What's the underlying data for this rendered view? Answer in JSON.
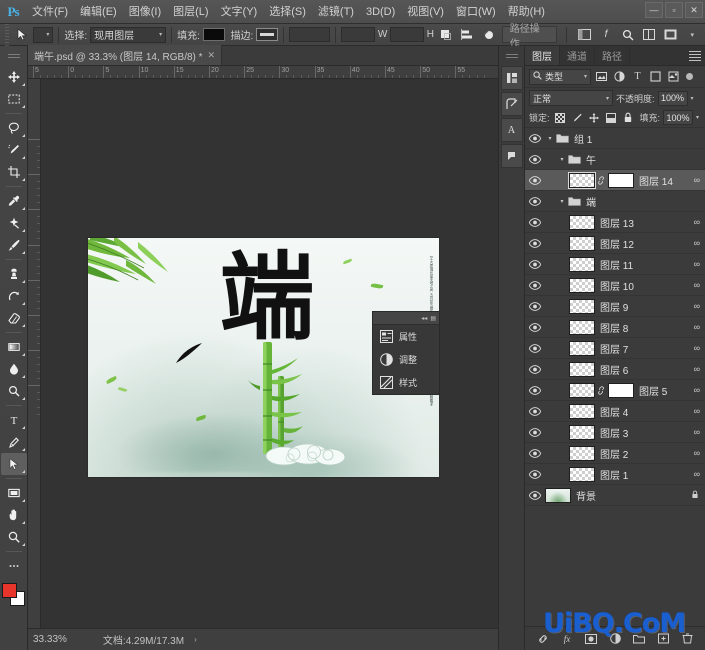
{
  "app": {
    "logo": "Ps",
    "window_buttons": [
      "—",
      "▫",
      "✕"
    ]
  },
  "menubar": {
    "items": [
      {
        "label": "文件(F)",
        "name": "menu-file"
      },
      {
        "label": "编辑(E)",
        "name": "menu-edit"
      },
      {
        "label": "图像(I)",
        "name": "menu-image"
      },
      {
        "label": "图层(L)",
        "name": "menu-layer"
      },
      {
        "label": "文字(Y)",
        "name": "menu-type"
      },
      {
        "label": "选择(S)",
        "name": "menu-select"
      },
      {
        "label": "滤镜(T)",
        "name": "menu-filter"
      },
      {
        "label": "3D(D)",
        "name": "menu-3d"
      },
      {
        "label": "视图(V)",
        "name": "menu-view"
      },
      {
        "label": "窗口(W)",
        "name": "menu-window"
      },
      {
        "label": "帮助(H)",
        "name": "menu-help"
      }
    ]
  },
  "options_bar": {
    "tool_icon": "path-selection-icon",
    "select_label": "选择:",
    "select_value": "现用图层",
    "fill_label": "填充:",
    "fill_color": "#0a0a0a",
    "stroke_label": "描边:",
    "stroke_color": "#d7d7d7",
    "width_value": "",
    "width_unit": "W",
    "height_value": "",
    "height_unit": "H",
    "op_label": "路径操作",
    "align_title": "对齐",
    "arrange_title": "排列",
    "extra_title": "更多选项"
  },
  "document_tab": {
    "title": "端午.psd @ 33.3% (图层 14, RGB/8) *",
    "close": "✕"
  },
  "toolbar": {
    "tools": [
      {
        "name": "move-tool",
        "glyph": "✥",
        "active": false
      },
      {
        "name": "marquee-tool",
        "glyph": "▭",
        "active": false
      },
      {
        "name": "lasso-tool",
        "glyph": "◯",
        "active": false
      },
      {
        "name": "quick-selection-tool",
        "glyph": "✎",
        "active": false
      },
      {
        "name": "crop-tool",
        "glyph": "⌗",
        "active": false
      },
      {
        "name": "eyedropper-tool",
        "glyph": "✒",
        "active": false
      },
      {
        "name": "healing-brush-tool",
        "glyph": "✜",
        "active": false
      },
      {
        "name": "brush-tool",
        "glyph": "🖌",
        "active": false
      },
      {
        "name": "clone-stamp-tool",
        "glyph": "⎈",
        "active": false
      },
      {
        "name": "history-brush-tool",
        "glyph": "✾",
        "active": false
      },
      {
        "name": "eraser-tool",
        "glyph": "◫",
        "active": false
      },
      {
        "name": "gradient-tool",
        "glyph": "▤",
        "active": false
      },
      {
        "name": "blur-tool",
        "glyph": "💧",
        "active": false
      },
      {
        "name": "dodge-tool",
        "glyph": "◐",
        "active": false
      },
      {
        "name": "type-tool",
        "glyph": "T",
        "active": false
      },
      {
        "name": "pen-tool",
        "glyph": "✐",
        "active": false
      },
      {
        "name": "path-selection-tool",
        "glyph": "➤",
        "active": true
      },
      {
        "name": "rectangle-shape-tool",
        "glyph": "▥",
        "active": false
      },
      {
        "name": "hand-tool",
        "glyph": "✋",
        "active": false
      },
      {
        "name": "zoom-tool",
        "glyph": "🔍",
        "active": false
      },
      {
        "name": "more-tools",
        "glyph": "•••",
        "active": false
      }
    ],
    "foreground_color": "#e8352b",
    "background_color": "#ffffff"
  },
  "ruler": {
    "h_labels": [
      "5",
      "0",
      "5",
      "10",
      "15",
      "20",
      "25",
      "30",
      "35",
      "40",
      "45",
      "50",
      "55"
    ],
    "v_labels": [
      "0",
      "5",
      "10",
      "15",
      "20",
      "25",
      "30",
      "35"
    ]
  },
  "canvas": {
    "artwork_title": "端",
    "vertical_poem": [
      "粽叶飘香艾草青绿龙舟竞渡锣鼓喧天",
      "五月初五端午佳节赛龙舟吃粽子挂艾叶",
      "屈子行吟泽畔千古忠魂长留天地之间"
    ],
    "mini_panel": {
      "collapse": "◂◂",
      "menu": "▤",
      "items": [
        {
          "label": "属性",
          "icon": "properties-icon"
        },
        {
          "label": "调整",
          "icon": "adjustments-icon"
        },
        {
          "label": "样式",
          "icon": "styles-icon"
        }
      ]
    }
  },
  "status_bar": {
    "zoom": "33.33%",
    "doc_info": "文档:4.29M/17.3M",
    "arrow": "›"
  },
  "rail": {
    "icons": [
      {
        "name": "history-panel-icon",
        "glyph": "⎘"
      },
      {
        "name": "color-panel-icon",
        "glyph": "◉"
      },
      {
        "name": "character-panel-icon",
        "glyph": "A"
      },
      {
        "name": "brush-presets-icon",
        "glyph": "◤"
      }
    ]
  },
  "layers_panel": {
    "tabs": [
      {
        "label": "图层",
        "active": true
      },
      {
        "label": "通道",
        "active": false
      },
      {
        "label": "路径",
        "active": false
      }
    ],
    "filter": {
      "search_icon": "search-icon",
      "kind_value": "类型",
      "icons": [
        {
          "name": "filter-pixel-icon",
          "glyph": "▣"
        },
        {
          "name": "filter-adjustment-icon",
          "glyph": "◑"
        },
        {
          "name": "filter-type-icon",
          "glyph": "T"
        },
        {
          "name": "filter-shape-icon",
          "glyph": "▢"
        },
        {
          "name": "filter-smart-object-icon",
          "glyph": "◱"
        }
      ],
      "toggle": "filter-enable-toggle"
    },
    "blend_mode_label": "正常",
    "opacity_label": "不透明度:",
    "opacity_value": "100%",
    "lock_label": "锁定:",
    "lock_icons": [
      {
        "name": "lock-transparent-pixels-icon",
        "glyph": "▩"
      },
      {
        "name": "lock-image-pixels-icon",
        "glyph": "🖌"
      },
      {
        "name": "lock-position-icon",
        "glyph": "✥"
      },
      {
        "name": "lock-artboard-nesting-icon",
        "glyph": "⬓"
      },
      {
        "name": "lock-all-icon",
        "glyph": "🔒"
      }
    ],
    "fill_label": "填充:",
    "fill_value": "100%",
    "layers": [
      {
        "name": "组 1",
        "type": "group",
        "indent": 0,
        "visible": true,
        "expanded": true,
        "selected": false,
        "linked": false,
        "locked": false
      },
      {
        "name": "午",
        "type": "group",
        "indent": 1,
        "visible": true,
        "expanded": true,
        "selected": false,
        "linked": false,
        "locked": false
      },
      {
        "name": "图层 14",
        "type": "layer-with-mask",
        "indent": 2,
        "visible": true,
        "expanded": false,
        "selected": true,
        "linked": true,
        "locked": false
      },
      {
        "name": "端",
        "type": "group",
        "indent": 1,
        "visible": true,
        "expanded": true,
        "selected": false,
        "linked": false,
        "locked": false
      },
      {
        "name": "图层 13",
        "type": "layer",
        "indent": 2,
        "visible": true,
        "expanded": false,
        "selected": false,
        "linked": true,
        "locked": false
      },
      {
        "name": "图层 12",
        "type": "layer",
        "indent": 2,
        "visible": true,
        "expanded": false,
        "selected": false,
        "linked": true,
        "locked": false
      },
      {
        "name": "图层 11",
        "type": "layer",
        "indent": 2,
        "visible": true,
        "expanded": false,
        "selected": false,
        "linked": true,
        "locked": false
      },
      {
        "name": "图层 10",
        "type": "layer",
        "indent": 2,
        "visible": true,
        "expanded": false,
        "selected": false,
        "linked": true,
        "locked": false
      },
      {
        "name": "图层 9",
        "type": "layer",
        "indent": 2,
        "visible": true,
        "expanded": false,
        "selected": false,
        "linked": true,
        "locked": false
      },
      {
        "name": "图层 8",
        "type": "layer",
        "indent": 2,
        "visible": true,
        "expanded": false,
        "selected": false,
        "linked": true,
        "locked": false
      },
      {
        "name": "图层 7",
        "type": "layer",
        "indent": 2,
        "visible": true,
        "expanded": false,
        "selected": false,
        "linked": true,
        "locked": false
      },
      {
        "name": "图层 6",
        "type": "layer",
        "indent": 2,
        "visible": true,
        "expanded": false,
        "selected": false,
        "linked": true,
        "locked": false
      },
      {
        "name": "图层 5",
        "type": "layer-with-mask",
        "indent": 2,
        "visible": true,
        "expanded": false,
        "selected": false,
        "linked": true,
        "locked": false
      },
      {
        "name": "图层 4",
        "type": "layer",
        "indent": 2,
        "visible": true,
        "expanded": false,
        "selected": false,
        "linked": true,
        "locked": false
      },
      {
        "name": "图层 3",
        "type": "layer",
        "indent": 2,
        "visible": true,
        "expanded": false,
        "selected": false,
        "linked": true,
        "locked": false
      },
      {
        "name": "图层 2",
        "type": "layer",
        "indent": 2,
        "visible": true,
        "expanded": false,
        "selected": false,
        "linked": true,
        "locked": false
      },
      {
        "name": "图层 1",
        "type": "layer",
        "indent": 2,
        "visible": true,
        "expanded": false,
        "selected": false,
        "linked": true,
        "locked": false
      },
      {
        "name": "背景",
        "type": "background",
        "indent": 0,
        "visible": true,
        "expanded": false,
        "selected": false,
        "linked": false,
        "locked": true
      }
    ],
    "footer_icons": [
      {
        "name": "link-layers-icon",
        "glyph": "⛓"
      },
      {
        "name": "layer-style-icon",
        "glyph": "fx"
      },
      {
        "name": "add-layer-mask-icon",
        "glyph": "◧"
      },
      {
        "name": "new-fill-adjustment-icon",
        "glyph": "◐"
      },
      {
        "name": "new-group-icon",
        "glyph": "🗀"
      },
      {
        "name": "new-layer-icon",
        "glyph": "⊞"
      },
      {
        "name": "delete-layer-icon",
        "glyph": "🗑"
      }
    ]
  },
  "watermark": {
    "text": "UiBQ.CoM",
    "color": "#1a5fd0"
  }
}
